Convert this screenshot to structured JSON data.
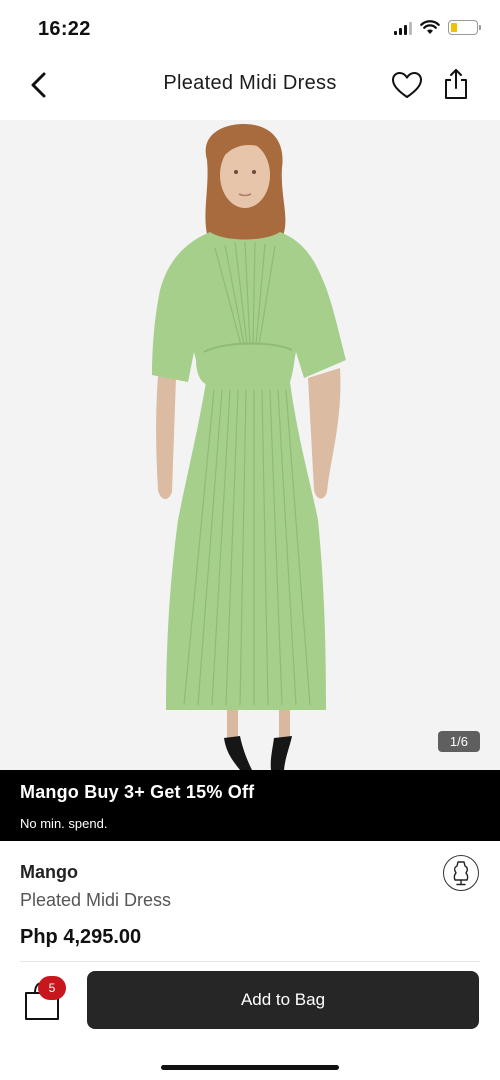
{
  "status_bar": {
    "time": "16:22"
  },
  "nav": {
    "title": "Pleated Midi Dress"
  },
  "gallery": {
    "counter": "1/6"
  },
  "promo": {
    "title": "Mango Buy 3+ Get 15% Off",
    "subtitle": "No min. spend."
  },
  "product": {
    "brand": "Mango",
    "name": "Pleated Midi Dress",
    "price": "Php 4,295.00"
  },
  "bag": {
    "count": "5"
  },
  "cta": {
    "add_to_bag": "Add to Bag"
  },
  "colors": {
    "dress_green": "#a6cf8c",
    "badge_red": "#c8161d",
    "button_dark": "#262626"
  }
}
